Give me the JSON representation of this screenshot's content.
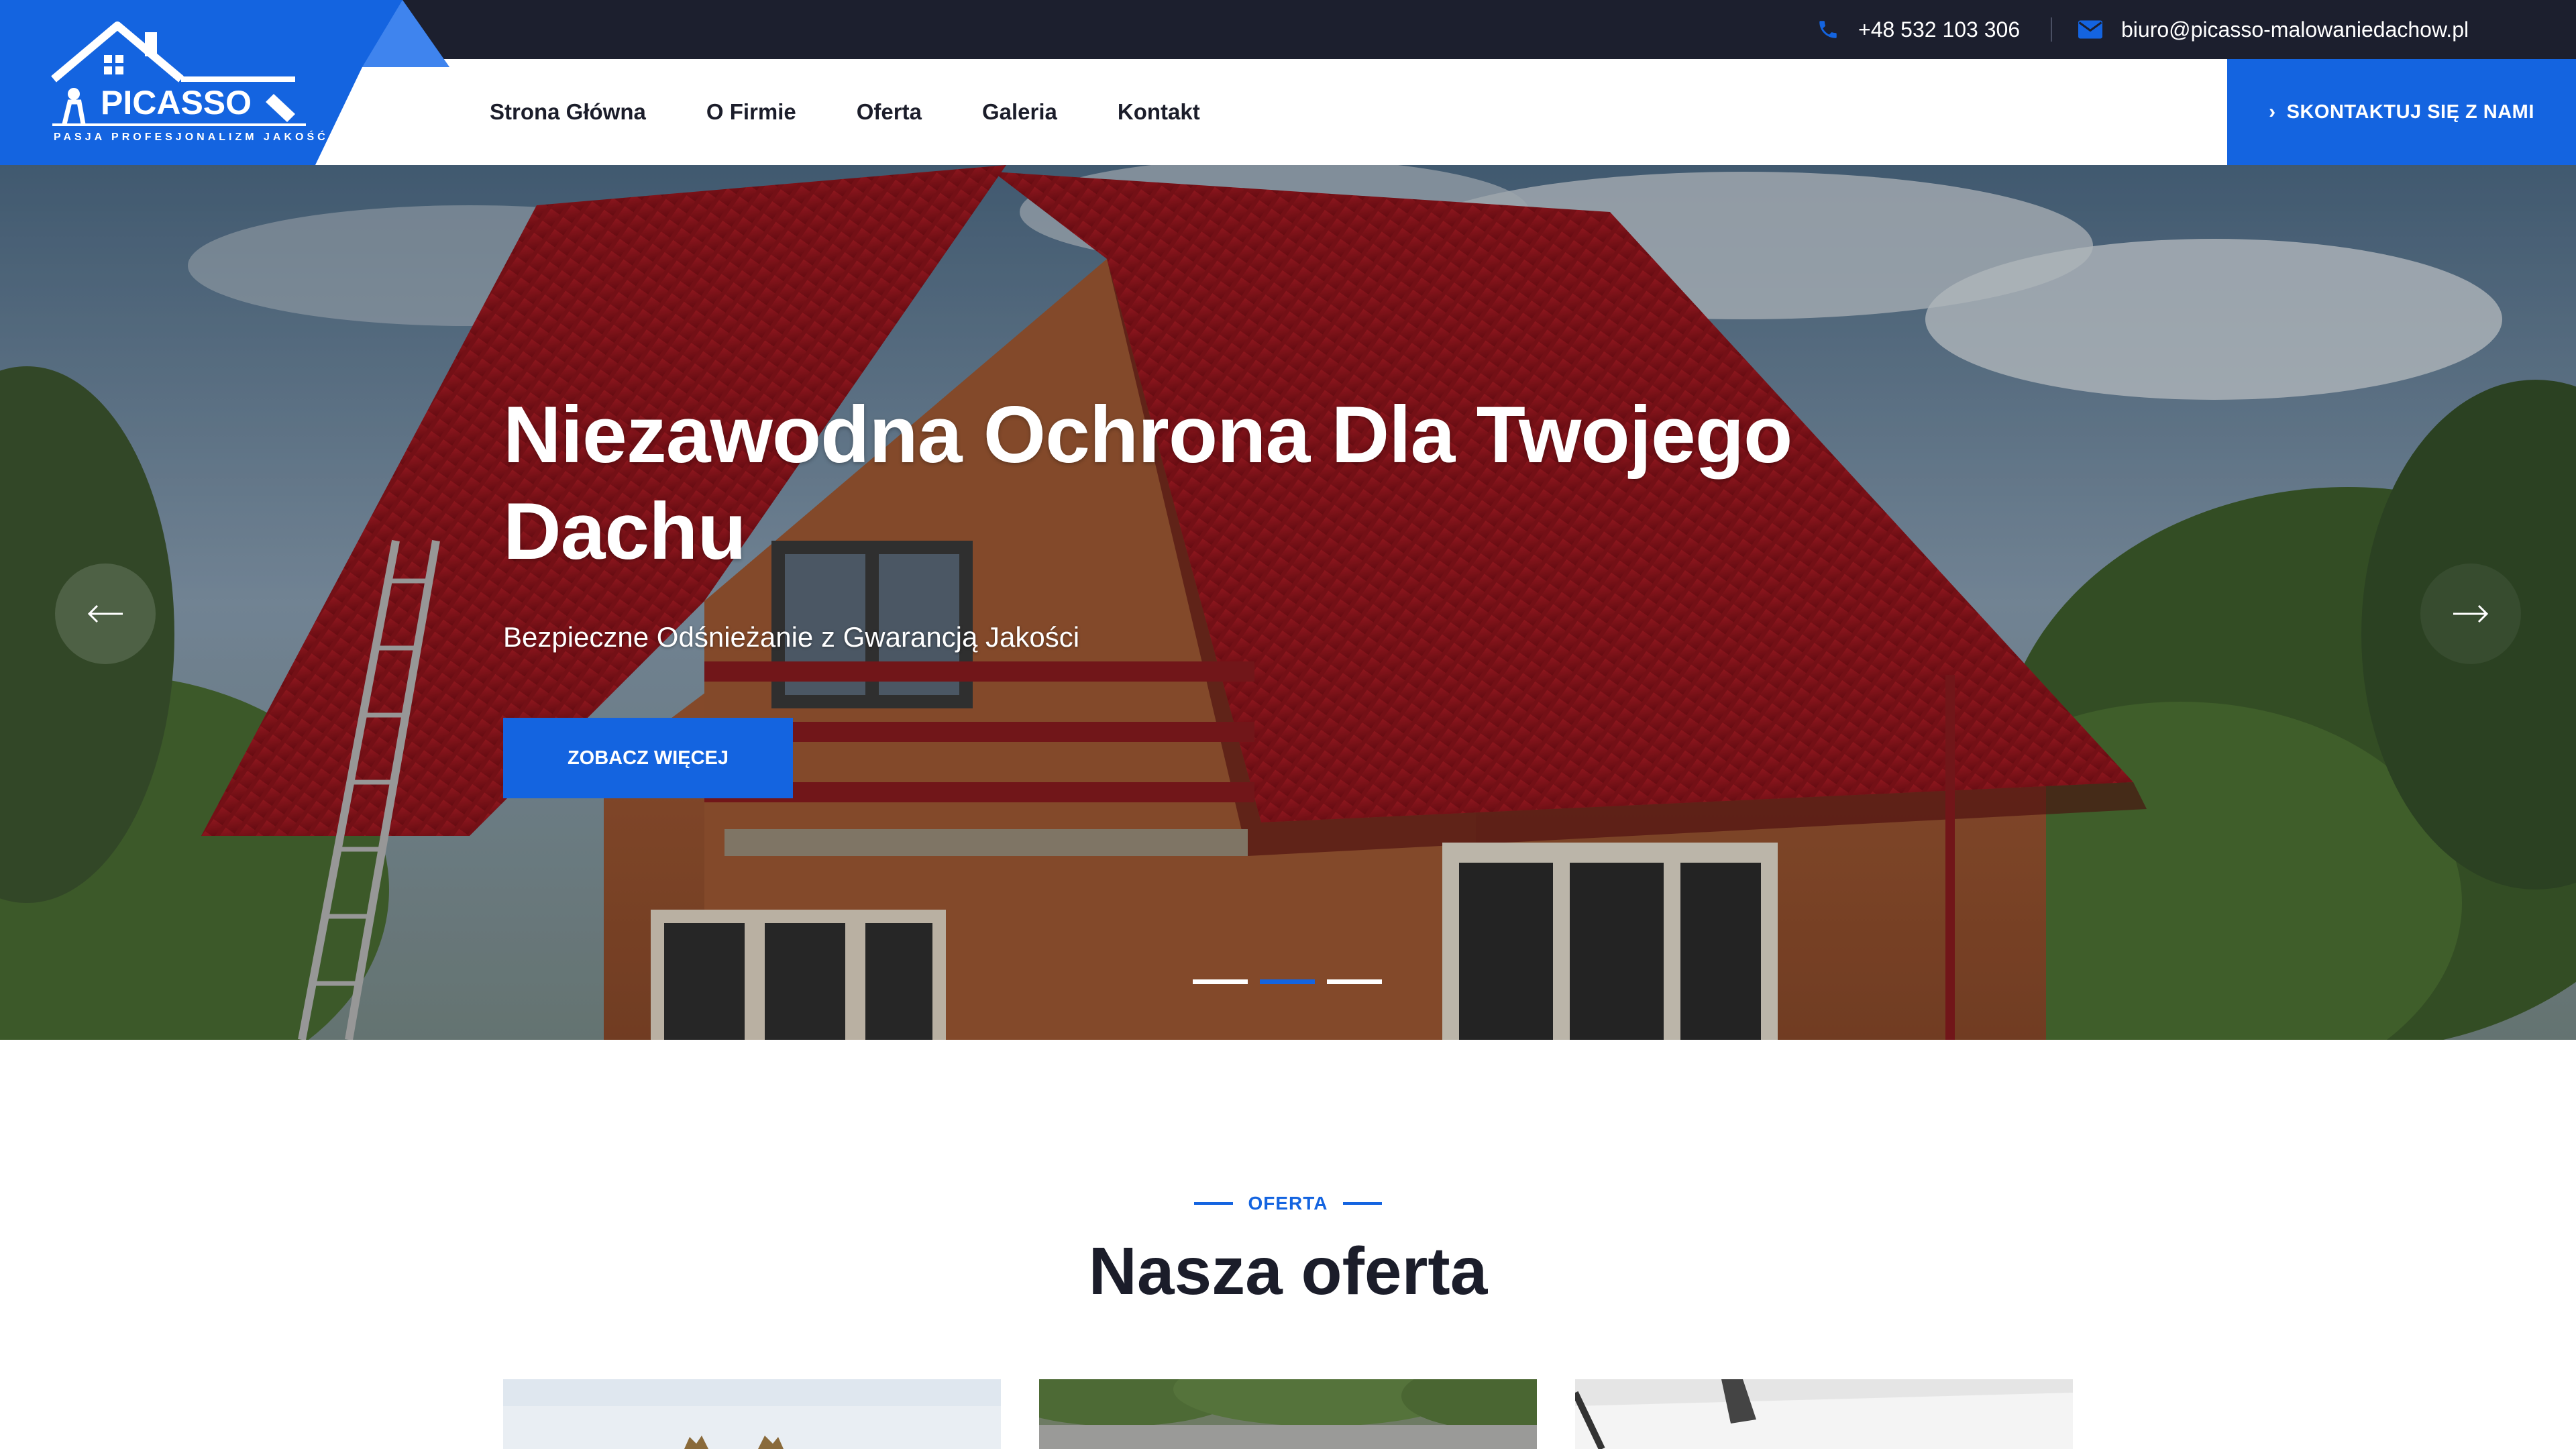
{
  "topbar": {
    "phone": "+48 532 103 306",
    "email": "biuro@picasso-malowaniedachow.pl"
  },
  "logo": {
    "name": "PICASSO",
    "tagline": "PASJA PROFESJONALIZM JAKOŚĆ"
  },
  "nav": {
    "items": [
      {
        "label": "Strona Główna"
      },
      {
        "label": "O Firmie"
      },
      {
        "label": "Oferta"
      },
      {
        "label": "Galeria"
      },
      {
        "label": "Kontakt"
      }
    ],
    "cta_label": "SKONTAKTUJ SIĘ Z NAMI"
  },
  "hero": {
    "title_line1": "Niezawodna Ochrona Dla Twojego",
    "title_line2": "Dachu",
    "subtitle": "Bezpieczne Odśnieżanie z Gwarancją Jakości",
    "button_label": "ZOBACZ WIĘCEJ",
    "slide_count": 3,
    "active_slide": 2
  },
  "offer_section": {
    "kicker": "OFERTA",
    "title": "Nasza oferta"
  },
  "colors": {
    "accent": "#1464e0",
    "topbar_bg": "#1c1f2e",
    "text_dark": "#1b1d2a"
  },
  "icons": {
    "phone": "phone-icon",
    "email": "email-icon",
    "cta": "chevron-right-icon",
    "prev": "arrow-left-icon",
    "next": "arrow-right-icon"
  }
}
